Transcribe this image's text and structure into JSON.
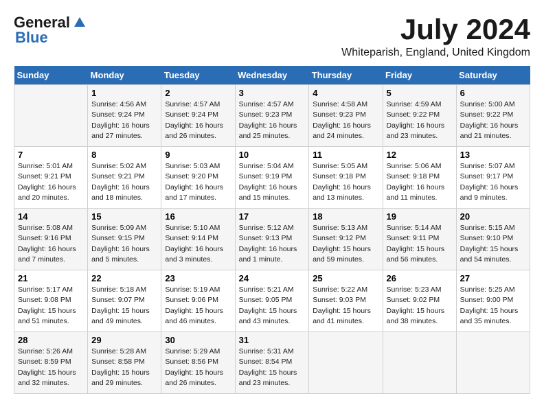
{
  "logo": {
    "general": "General",
    "blue": "Blue"
  },
  "title": "July 2024",
  "location": "Whiteparish, England, United Kingdom",
  "days_header": [
    "Sunday",
    "Monday",
    "Tuesday",
    "Wednesday",
    "Thursday",
    "Friday",
    "Saturday"
  ],
  "weeks": [
    [
      {
        "day": "",
        "sunrise": "",
        "sunset": "",
        "daylight": ""
      },
      {
        "day": "1",
        "sunrise": "Sunrise: 4:56 AM",
        "sunset": "Sunset: 9:24 PM",
        "daylight": "Daylight: 16 hours and 27 minutes."
      },
      {
        "day": "2",
        "sunrise": "Sunrise: 4:57 AM",
        "sunset": "Sunset: 9:24 PM",
        "daylight": "Daylight: 16 hours and 26 minutes."
      },
      {
        "day": "3",
        "sunrise": "Sunrise: 4:57 AM",
        "sunset": "Sunset: 9:23 PM",
        "daylight": "Daylight: 16 hours and 25 minutes."
      },
      {
        "day": "4",
        "sunrise": "Sunrise: 4:58 AM",
        "sunset": "Sunset: 9:23 PM",
        "daylight": "Daylight: 16 hours and 24 minutes."
      },
      {
        "day": "5",
        "sunrise": "Sunrise: 4:59 AM",
        "sunset": "Sunset: 9:22 PM",
        "daylight": "Daylight: 16 hours and 23 minutes."
      },
      {
        "day": "6",
        "sunrise": "Sunrise: 5:00 AM",
        "sunset": "Sunset: 9:22 PM",
        "daylight": "Daylight: 16 hours and 21 minutes."
      }
    ],
    [
      {
        "day": "7",
        "sunrise": "Sunrise: 5:01 AM",
        "sunset": "Sunset: 9:21 PM",
        "daylight": "Daylight: 16 hours and 20 minutes."
      },
      {
        "day": "8",
        "sunrise": "Sunrise: 5:02 AM",
        "sunset": "Sunset: 9:21 PM",
        "daylight": "Daylight: 16 hours and 18 minutes."
      },
      {
        "day": "9",
        "sunrise": "Sunrise: 5:03 AM",
        "sunset": "Sunset: 9:20 PM",
        "daylight": "Daylight: 16 hours and 17 minutes."
      },
      {
        "day": "10",
        "sunrise": "Sunrise: 5:04 AM",
        "sunset": "Sunset: 9:19 PM",
        "daylight": "Daylight: 16 hours and 15 minutes."
      },
      {
        "day": "11",
        "sunrise": "Sunrise: 5:05 AM",
        "sunset": "Sunset: 9:18 PM",
        "daylight": "Daylight: 16 hours and 13 minutes."
      },
      {
        "day": "12",
        "sunrise": "Sunrise: 5:06 AM",
        "sunset": "Sunset: 9:18 PM",
        "daylight": "Daylight: 16 hours and 11 minutes."
      },
      {
        "day": "13",
        "sunrise": "Sunrise: 5:07 AM",
        "sunset": "Sunset: 9:17 PM",
        "daylight": "Daylight: 16 hours and 9 minutes."
      }
    ],
    [
      {
        "day": "14",
        "sunrise": "Sunrise: 5:08 AM",
        "sunset": "Sunset: 9:16 PM",
        "daylight": "Daylight: 16 hours and 7 minutes."
      },
      {
        "day": "15",
        "sunrise": "Sunrise: 5:09 AM",
        "sunset": "Sunset: 9:15 PM",
        "daylight": "Daylight: 16 hours and 5 minutes."
      },
      {
        "day": "16",
        "sunrise": "Sunrise: 5:10 AM",
        "sunset": "Sunset: 9:14 PM",
        "daylight": "Daylight: 16 hours and 3 minutes."
      },
      {
        "day": "17",
        "sunrise": "Sunrise: 5:12 AM",
        "sunset": "Sunset: 9:13 PM",
        "daylight": "Daylight: 16 hours and 1 minute."
      },
      {
        "day": "18",
        "sunrise": "Sunrise: 5:13 AM",
        "sunset": "Sunset: 9:12 PM",
        "daylight": "Daylight: 15 hours and 59 minutes."
      },
      {
        "day": "19",
        "sunrise": "Sunrise: 5:14 AM",
        "sunset": "Sunset: 9:11 PM",
        "daylight": "Daylight: 15 hours and 56 minutes."
      },
      {
        "day": "20",
        "sunrise": "Sunrise: 5:15 AM",
        "sunset": "Sunset: 9:10 PM",
        "daylight": "Daylight: 15 hours and 54 minutes."
      }
    ],
    [
      {
        "day": "21",
        "sunrise": "Sunrise: 5:17 AM",
        "sunset": "Sunset: 9:08 PM",
        "daylight": "Daylight: 15 hours and 51 minutes."
      },
      {
        "day": "22",
        "sunrise": "Sunrise: 5:18 AM",
        "sunset": "Sunset: 9:07 PM",
        "daylight": "Daylight: 15 hours and 49 minutes."
      },
      {
        "day": "23",
        "sunrise": "Sunrise: 5:19 AM",
        "sunset": "Sunset: 9:06 PM",
        "daylight": "Daylight: 15 hours and 46 minutes."
      },
      {
        "day": "24",
        "sunrise": "Sunrise: 5:21 AM",
        "sunset": "Sunset: 9:05 PM",
        "daylight": "Daylight: 15 hours and 43 minutes."
      },
      {
        "day": "25",
        "sunrise": "Sunrise: 5:22 AM",
        "sunset": "Sunset: 9:03 PM",
        "daylight": "Daylight: 15 hours and 41 minutes."
      },
      {
        "day": "26",
        "sunrise": "Sunrise: 5:23 AM",
        "sunset": "Sunset: 9:02 PM",
        "daylight": "Daylight: 15 hours and 38 minutes."
      },
      {
        "day": "27",
        "sunrise": "Sunrise: 5:25 AM",
        "sunset": "Sunset: 9:00 PM",
        "daylight": "Daylight: 15 hours and 35 minutes."
      }
    ],
    [
      {
        "day": "28",
        "sunrise": "Sunrise: 5:26 AM",
        "sunset": "Sunset: 8:59 PM",
        "daylight": "Daylight: 15 hours and 32 minutes."
      },
      {
        "day": "29",
        "sunrise": "Sunrise: 5:28 AM",
        "sunset": "Sunset: 8:58 PM",
        "daylight": "Daylight: 15 hours and 29 minutes."
      },
      {
        "day": "30",
        "sunrise": "Sunrise: 5:29 AM",
        "sunset": "Sunset: 8:56 PM",
        "daylight": "Daylight: 15 hours and 26 minutes."
      },
      {
        "day": "31",
        "sunrise": "Sunrise: 5:31 AM",
        "sunset": "Sunset: 8:54 PM",
        "daylight": "Daylight: 15 hours and 23 minutes."
      },
      {
        "day": "",
        "sunrise": "",
        "sunset": "",
        "daylight": ""
      },
      {
        "day": "",
        "sunrise": "",
        "sunset": "",
        "daylight": ""
      },
      {
        "day": "",
        "sunrise": "",
        "sunset": "",
        "daylight": ""
      }
    ]
  ]
}
